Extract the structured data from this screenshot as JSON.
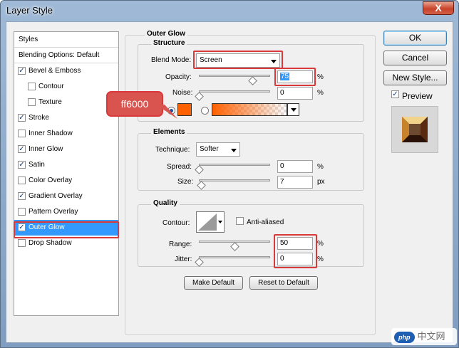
{
  "window": {
    "title": "Layer Style",
    "close_label": "X"
  },
  "left_list": {
    "items": [
      {
        "label": "Styles",
        "checked": null
      },
      {
        "label": "Blending Options: Default",
        "checked": null
      },
      {
        "label": "Bevel & Emboss",
        "checked": true
      },
      {
        "label": "Contour",
        "checked": false
      },
      {
        "label": "Texture",
        "checked": false
      },
      {
        "label": "Stroke",
        "checked": true
      },
      {
        "label": "Inner Shadow",
        "checked": false
      },
      {
        "label": "Inner Glow",
        "checked": true
      },
      {
        "label": "Satin",
        "checked": true
      },
      {
        "label": "Color Overlay",
        "checked": false
      },
      {
        "label": "Gradient Overlay",
        "checked": true
      },
      {
        "label": "Pattern Overlay",
        "checked": false
      },
      {
        "label": "Outer Glow",
        "checked": true
      },
      {
        "label": "Drop Shadow",
        "checked": false
      }
    ]
  },
  "panel": {
    "title": "Outer Glow",
    "structure": {
      "title": "Structure",
      "blend_mode_label": "Blend Mode:",
      "blend_mode_value": "Screen",
      "opacity_label": "Opacity:",
      "opacity_value": "75",
      "opacity_level": 0.75,
      "noise_label": "Noise:",
      "noise_value": "0",
      "noise_level": 0,
      "unit": "%",
      "color": "#ff6000"
    },
    "elements": {
      "title": "Elements",
      "technique_label": "Technique:",
      "technique_value": "Softer",
      "spread_label": "Spread:",
      "spread_value": "0",
      "spread_level": 0,
      "size_label": "Size:",
      "size_value": "7",
      "size_level": 0.03,
      "percent_unit": "%",
      "px_unit": "px"
    },
    "quality": {
      "title": "Quality",
      "contour_label": "Contour:",
      "anti_aliased_label": "Anti-aliased",
      "range_label": "Range:",
      "range_value": "50",
      "range_level": 0.5,
      "jitter_label": "Jitter:",
      "jitter_value": "0",
      "jitter_level": 0,
      "unit": "%"
    },
    "make_default_label": "Make Default",
    "reset_default_label": "Reset to Default"
  },
  "actions": {
    "ok_label": "OK",
    "cancel_label": "Cancel",
    "new_style_label": "New Style...",
    "preview_label": "Preview",
    "preview_checked": true
  },
  "annotation": {
    "callout_text": "ff6000"
  },
  "watermark": {
    "badge": "php",
    "text": "中文网"
  }
}
